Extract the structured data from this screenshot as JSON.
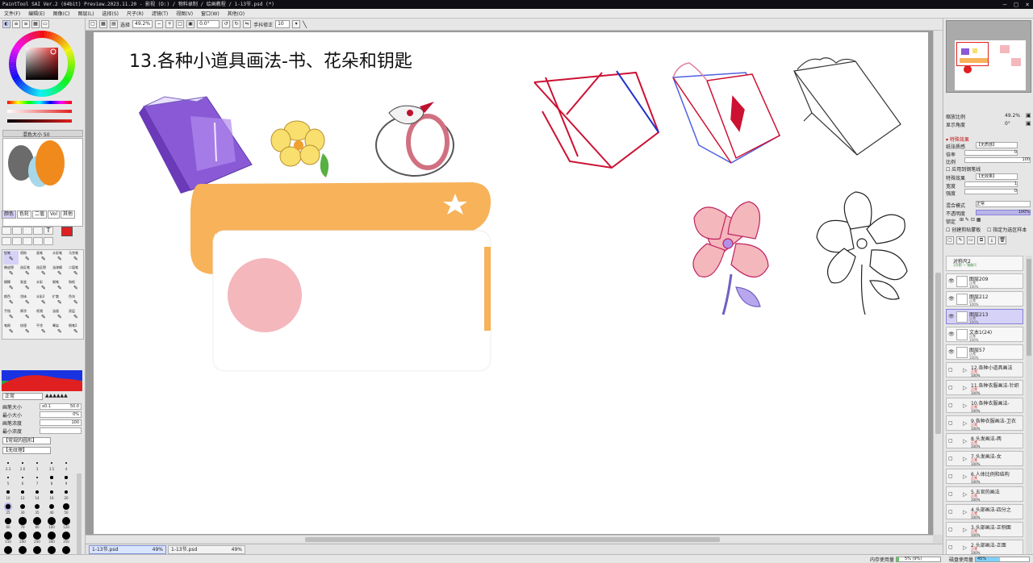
{
  "window": {
    "title": "PaintTool SAI Ver.2 (64bit) Preview.2023.11.20 - 影视 (D:) / 物料录制 / 绘画教程 / 1-13节.psd (*)",
    "controls": [
      "–",
      "□",
      "×"
    ]
  },
  "menu": [
    "文件(F)",
    "编辑(E)",
    "图像(C)",
    "图层(L)",
    "选择(S)",
    "尺子(R)",
    "滤镜(T)",
    "视图(V)",
    "窗口(W)",
    "其他(O)"
  ],
  "toolbar": {
    "select_label": "选择",
    "zoom": "49.2%",
    "rotation": "0.0°",
    "stabilizer_label": "手抖修正",
    "stabilizer_value": "10"
  },
  "canvas": {
    "heading": "13.各种小道具画法-书、花朵和钥匙",
    "colors": {
      "orange": "#f7b25a",
      "pink": "#f4b7bc",
      "red_ink": "#cc1133",
      "blue_ink": "#2233cc",
      "purple": "#8a5ad6",
      "yellow": "#f8df6e"
    }
  },
  "doc_tabs": [
    {
      "name": "1-13节.psd",
      "zoom": "49%"
    },
    {
      "name": "1-13节.psd",
      "zoom": "49%"
    }
  ],
  "left_panel": {
    "brush_size_label": "画笔大小",
    "brush_size_mult": "x0.1",
    "brush_size_value": "50.0",
    "min_size_label": "最小大小",
    "min_size_value": "0%",
    "density_label": "画笔浓度",
    "density_value": "100",
    "min_density_label": "最小浓度",
    "blend_mode": "正常",
    "texture_1": "【常规的圆形】",
    "texture_2": "【无纹理】",
    "brush_sizes": [
      "2.3",
      "2.6",
      "3",
      "3.5",
      "4",
      "5",
      "6",
      "7",
      "8",
      "9",
      "10",
      "12",
      "14",
      "16",
      "20",
      "25",
      "30",
      "35",
      "40",
      "50",
      "60",
      "70",
      "80",
      "100",
      "120",
      "150",
      "200",
      "250",
      "300",
      "350",
      "400",
      "500",
      "600",
      "700",
      "800"
    ],
    "tool_names": [
      "铅笔",
      "喷枪",
      "画笔",
      "水彩笔",
      "马克笔",
      "橡皮擦",
      "选区笔",
      "选区擦",
      "油漆桶",
      "二值笔",
      "模糊",
      "渐变",
      "水彩",
      "钢笔",
      "和纸",
      "颜色",
      "涂抹",
      "水彩2",
      "扩散",
      "色块",
      "手指",
      "厚涂",
      "喷溅",
      "油画",
      "双层",
      "笔刷",
      "纹理",
      "平涂",
      "晕染",
      "钢笔2"
    ],
    "tabs": [
      "颜色",
      "色轮",
      "二值",
      "Vol",
      "其他"
    ],
    "size_value": "50"
  },
  "right_panel": {
    "zoom_label": "缩放比例",
    "zoom_value": "49.2%",
    "angle_label": "显示角度",
    "angle_value": "0°",
    "special_effect_label": "特殊效果",
    "texture_label": "纸张质感",
    "texture_value": "【无质感】",
    "scale_label": "倍率",
    "scale_value": "0",
    "ratio_label": "比例",
    "ratio_value": "100",
    "pen_texture_label": "应用到钢笔线",
    "effect_label": "特殊效果",
    "effect_value": "【无效果】",
    "width_label": "宽度",
    "width_value": "1",
    "strength_label": "强度",
    "strength_value": "0",
    "blend_label": "混合模式",
    "blend_value": "正常",
    "opacity_label": "不透明度",
    "opacity_value": "100%",
    "lock_label": "锁定",
    "clip_label": "创建剪贴蒙板",
    "ref_label": "指定为选区样本",
    "layers": [
      {
        "name": "对称尺2",
        "mode": "1分割 — 镜像尺",
        "opacity": "",
        "type": "ruler"
      },
      {
        "name": "图层209",
        "mode": "正常",
        "opacity": "100%",
        "type": "layer"
      },
      {
        "name": "图层212",
        "mode": "正常",
        "opacity": "100%",
        "type": "layer"
      },
      {
        "name": "图层213",
        "mode": "正常",
        "opacity": "100%",
        "type": "layer",
        "selected": true
      },
      {
        "name": "文本1(24)",
        "mode": "正常",
        "opacity": "100%",
        "type": "layer"
      },
      {
        "name": "图层57",
        "mode": "正常",
        "opacity": "100%",
        "type": "layer"
      },
      {
        "name": "12.各种小道具画法",
        "mode": "正常",
        "opacity": "100%",
        "type": "folder"
      },
      {
        "name": "11.各种衣服画法-针织",
        "mode": "正常",
        "opacity": "100%",
        "type": "folder"
      },
      {
        "name": "10.各种衣服画法-",
        "mode": "正常",
        "opacity": "100%",
        "type": "folder"
      },
      {
        "name": "9.各种衣服画法-卫衣",
        "mode": "正常",
        "opacity": "100%",
        "type": "folder"
      },
      {
        "name": "8.头发画法-两",
        "mode": "正常",
        "opacity": "100%",
        "type": "folder"
      },
      {
        "name": "7.头发画法-女",
        "mode": "正常",
        "opacity": "100%",
        "type": "folder"
      },
      {
        "name": "6.人体比例和结构",
        "mode": "正常",
        "opacity": "100%",
        "type": "folder"
      },
      {
        "name": "5.五官的画法",
        "mode": "正常",
        "opacity": "100%",
        "type": "folder"
      },
      {
        "name": "4.头部画法-四分之",
        "mode": "正常",
        "opacity": "100%",
        "type": "folder"
      },
      {
        "name": "3.头部画法-正侧面",
        "mode": "正常",
        "opacity": "100%",
        "type": "folder"
      },
      {
        "name": "2.头部画法-正面",
        "mode": "正常",
        "opacity": "100%",
        "type": "folder"
      }
    ]
  },
  "status": {
    "memory_label": "内存使用量",
    "memory_value": "5% (9%)",
    "memory_pct": 0.05,
    "disk_label": "磁盘使用量",
    "disk_value": "45%",
    "disk_pct": 0.45
  }
}
